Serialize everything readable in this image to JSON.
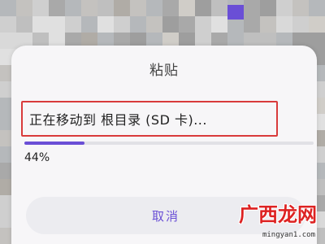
{
  "dialog": {
    "title": "粘贴",
    "status_text": "正在移动到 根目录 (SD 卡)...",
    "progress_fraction": 0.44,
    "progress_text": "44%",
    "cancel_label": "取消"
  },
  "colors": {
    "accent": "#6a4fd6",
    "highlight_border": "#d93b3b",
    "dialog_bg": "#f7f6f8"
  },
  "watermark": {
    "logo": "广西龙网",
    "url": "mingyan1.com"
  }
}
